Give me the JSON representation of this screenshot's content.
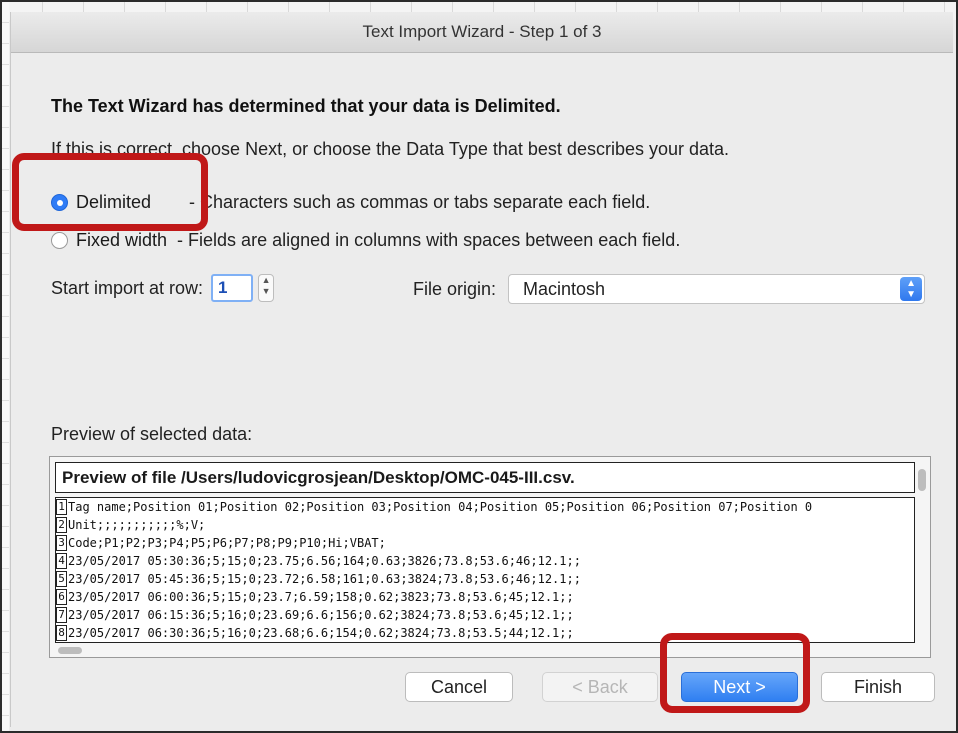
{
  "dialog": {
    "title": "Text Import Wizard - Step 1 of 3",
    "heading": "The Text Wizard has determined that your data is Delimited.",
    "instruction": "If this is correct, choose Next, or choose the Data Type that best describes your data."
  },
  "data_type": {
    "options": [
      {
        "label": "Delimited",
        "description": "- Characters such as commas or tabs separate each field.",
        "selected": true
      },
      {
        "label": "Fixed width",
        "description": "- Fields are aligned in columns with spaces between each field.",
        "selected": false
      }
    ]
  },
  "start_import": {
    "label": "Start import at row:",
    "value": "1"
  },
  "file_origin": {
    "label": "File origin:",
    "value": "Macintosh"
  },
  "preview": {
    "label": "Preview of selected data:",
    "header": "Preview of file /Users/ludovicgrosjean/Desktop/OMC-045-III.csv.",
    "lines": [
      {
        "num": "1",
        "text": "Tag name;Position 01;Position 02;Position 03;Position 04;Position 05;Position 06;Position 07;Position 0"
      },
      {
        "num": "2",
        "text": "Unit;;;;;;;;;;;%;V;"
      },
      {
        "num": "3",
        "text": "Code;P1;P2;P3;P4;P5;P6;P7;P8;P9;P10;Hi;VBAT;"
      },
      {
        "num": "4",
        "text": "23/05/2017 05:30:36;5;15;0;23.75;6.56;164;0.63;3826;73.8;53.6;46;12.1;;"
      },
      {
        "num": "5",
        "text": "23/05/2017 05:45:36;5;15;0;23.72;6.58;161;0.63;3824;73.8;53.6;46;12.1;;"
      },
      {
        "num": "6",
        "text": "23/05/2017 06:00:36;5;15;0;23.7;6.59;158;0.62;3823;73.8;53.6;45;12.1;;"
      },
      {
        "num": "7",
        "text": "23/05/2017 06:15:36;5;16;0;23.69;6.6;156;0.62;3824;73.8;53.6;45;12.1;;"
      },
      {
        "num": "8",
        "text": "23/05/2017 06:30:36;5;16;0;23.68;6.6;154;0.62;3824;73.8;53.5;44;12.1;;"
      }
    ]
  },
  "buttons": {
    "cancel": "Cancel",
    "back": "< Back",
    "next": "Next >",
    "finish": "Finish"
  },
  "colors": {
    "accent": "#2f7cf6",
    "highlight": "#c01818"
  }
}
